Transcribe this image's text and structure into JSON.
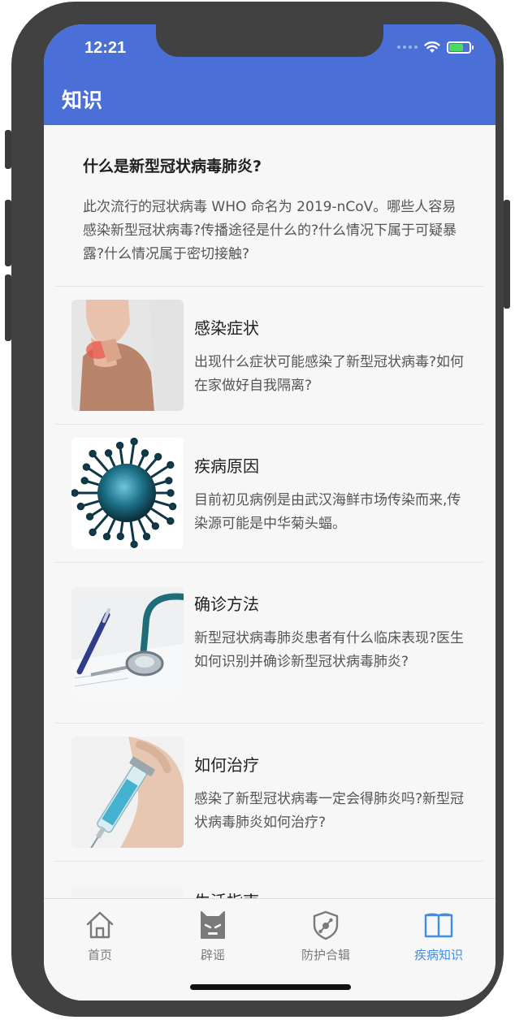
{
  "status_bar": {
    "time": "12:21"
  },
  "header": {
    "title": "知识"
  },
  "intro": {
    "title": "什么是新型冠状病毒肺炎?",
    "description": "此次流行的冠状病毒 WHO 命名为 2019-nCoV。哪些人容易感染新型冠状病毒?传播途径是什么的?什么情况下属于可疑暴露?什么情况属于密切接触?"
  },
  "items": [
    {
      "title": "感染症状",
      "description": "出现什么症状可能感染了新型冠状病毒?如何在家做好自我隔离?",
      "image": "sore-throat-woman-image"
    },
    {
      "title": "疾病原因",
      "description": "目前初见病例是由武汉海鲜市场传染而来,传染源可能是中华菊头蝠。",
      "image": "virus-image"
    },
    {
      "title": "确诊方法",
      "description": "新型冠状病毒肺炎患者有什么临床表现?医生如何识别并确诊新型冠状病毒肺炎?",
      "image": "stethoscope-image"
    },
    {
      "title": "如何治疗",
      "description": "感染了新型冠状病毒一定会得肺炎吗?新型冠状病毒肺炎如何治疗?",
      "image": "syringe-image"
    },
    {
      "title": "生活指南",
      "description": "",
      "image": "partial-image"
    }
  ],
  "tabs": [
    {
      "label": "首页",
      "icon": "home-icon"
    },
    {
      "label": "辟谣",
      "icon": "ghost-icon"
    },
    {
      "label": "防护合辑",
      "icon": "shield-icon"
    },
    {
      "label": "疾病知识",
      "icon": "book-icon",
      "active": true
    }
  ],
  "colors": {
    "header": "#4a70d8",
    "active_tab": "#3e8ee3",
    "inactive_tab": "#7a7a7a",
    "background": "#f7f7f7"
  }
}
